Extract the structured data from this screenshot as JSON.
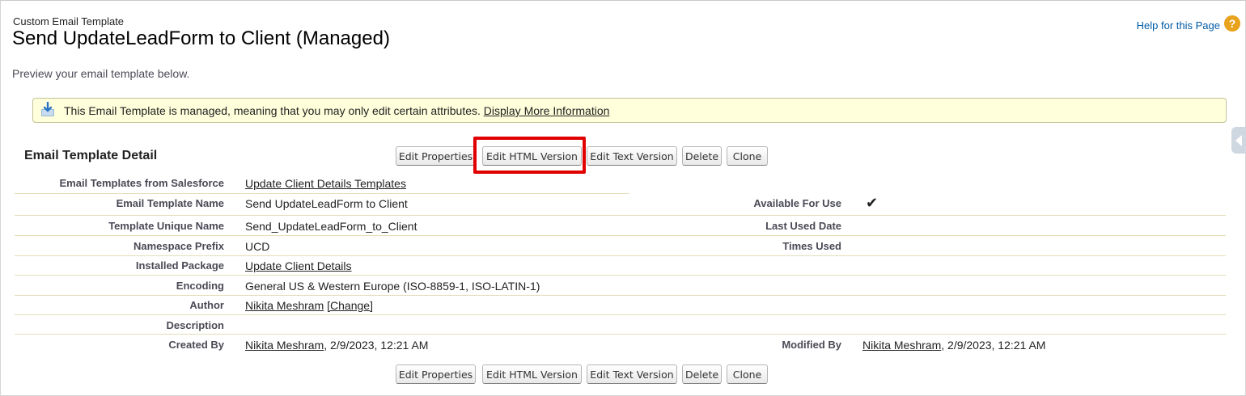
{
  "header": {
    "type_label": "Custom Email Template",
    "title": "Send UpdateLeadForm to Client (Managed)",
    "help_link": "Help for this Page",
    "help_icon": "question-icon",
    "description": "Preview your email template below."
  },
  "banner": {
    "icon": "download-package-icon",
    "message": "This Email Template is managed, meaning that you may only edit certain attributes.",
    "link": "Display More Information",
    "bg_color": "#ffffdc"
  },
  "detail": {
    "section_title": "Email Template Detail",
    "buttons": {
      "edit_properties": "Edit Properties",
      "edit_html": "Edit HTML Version",
      "edit_text": "Edit Text Version",
      "delete": "Delete",
      "clone": "Clone"
    },
    "highlight_color": "#e00000",
    "fields": {
      "folder": {
        "label": "Email Templates from Salesforce",
        "value": "Update Client Details Templates"
      },
      "name": {
        "label": "Email Template Name",
        "value": "Send UpdateLeadForm to Client"
      },
      "unique_name": {
        "label": "Template Unique Name",
        "value": "Send_UpdateLeadForm_to_Client"
      },
      "namespace": {
        "label": "Namespace Prefix",
        "value": "UCD"
      },
      "package": {
        "label": "Installed Package",
        "value": "Update Client Details"
      },
      "encoding": {
        "label": "Encoding",
        "value": "General US & Western Europe (ISO-8859-1, ISO-LATIN-1)"
      },
      "author": {
        "label": "Author",
        "value": "Nikita Meshram",
        "change": "[Change]"
      },
      "description": {
        "label": "Description",
        "value": ""
      },
      "created_by": {
        "label": "Created By",
        "user": "Nikita Meshram",
        "date": ", 2/9/2023, 12:21 AM"
      },
      "available": {
        "label": "Available For Use",
        "value": "✔"
      },
      "last_used": {
        "label": "Last Used Date",
        "value": ""
      },
      "times_used": {
        "label": "Times Used",
        "value": ""
      },
      "modified_by": {
        "label": "Modified By",
        "user": "Nikita Meshram",
        "date": ", 2/9/2023, 12:21 AM"
      }
    }
  }
}
